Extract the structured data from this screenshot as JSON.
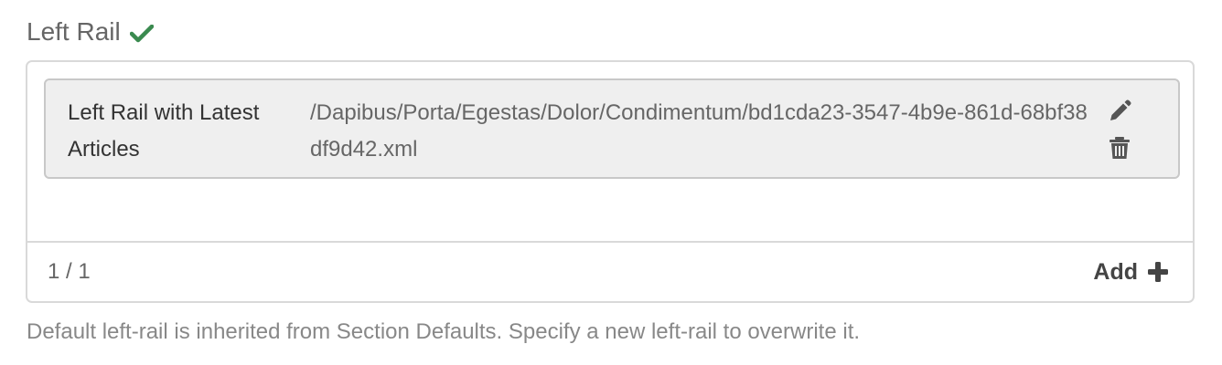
{
  "field": {
    "label": "Left Rail",
    "status_icon": "check-icon"
  },
  "item": {
    "title": "Left Rail with Latest Articles",
    "path": "/Dapibus/Porta/Egestas/Dolor/Condimentum/bd1cda23-3547-4b9e-861d-68bf38df9d42.xml",
    "edit_icon": "pencil-icon",
    "delete_icon": "trash-icon"
  },
  "footer": {
    "count": "1 / 1",
    "add_label": "Add",
    "add_icon": "plus-icon"
  },
  "help_text": "Default left-rail is inherited from Section Defaults. Specify a new left-rail to overwrite it.",
  "colors": {
    "check_green": "#3a8a4f",
    "icon_gray": "#555555"
  }
}
